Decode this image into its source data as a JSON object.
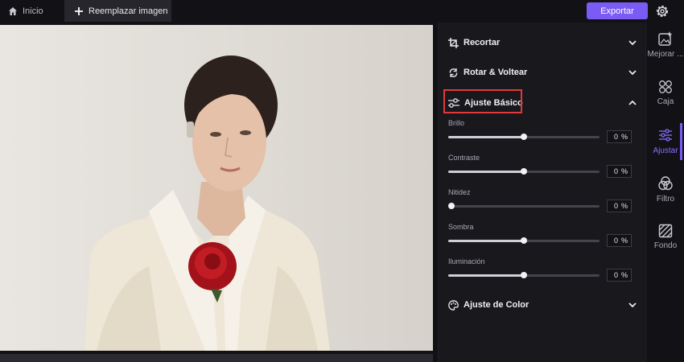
{
  "topbar": {
    "home_label": "Inicio",
    "replace_label": "Reemplazar imagen",
    "export_label": "Exportar",
    "home_icon": "home-icon",
    "settings_icon": "gear-icon"
  },
  "panel": {
    "sections": {
      "crop": {
        "label": "Recortar",
        "icon": "crop-icon",
        "expanded": false
      },
      "rotate": {
        "label": "Rotar & Voltear",
        "icon": "rotate-icon",
        "expanded": false
      },
      "basic": {
        "label": "Ajuste Básico",
        "icon": "sliders-icon",
        "expanded": true
      },
      "color": {
        "label": "Ajuste de Color",
        "icon": "palette-icon",
        "expanded": false
      }
    },
    "sliders": [
      {
        "name": "Brillo",
        "value": "0",
        "unit": "%",
        "level": 0.5
      },
      {
        "name": "Contraste",
        "value": "0",
        "unit": "%",
        "level": 0.5
      },
      {
        "name": "Nitidez",
        "value": "0",
        "unit": "%",
        "level": 0.0
      },
      {
        "name": "Sombra",
        "value": "0",
        "unit": "%",
        "level": 0.5
      },
      {
        "name": "Iluminación",
        "value": "0",
        "unit": "%",
        "level": 0.5
      }
    ]
  },
  "rail": [
    {
      "label": "Mejorar ...",
      "icon": "sparkle-image-icon",
      "active": false
    },
    {
      "label": "Caja",
      "icon": "grid-circles-icon",
      "active": false
    },
    {
      "label": "Ajustar",
      "icon": "adjust-sliders-icon",
      "active": true
    },
    {
      "label": "Filtro",
      "icon": "filter-circles-icon",
      "active": false
    },
    {
      "label": "Fondo",
      "icon": "background-icon",
      "active": false
    }
  ],
  "colors": {
    "accent": "#7a5cf5",
    "highlight": "#e03a3a",
    "panel": "#18181d"
  }
}
